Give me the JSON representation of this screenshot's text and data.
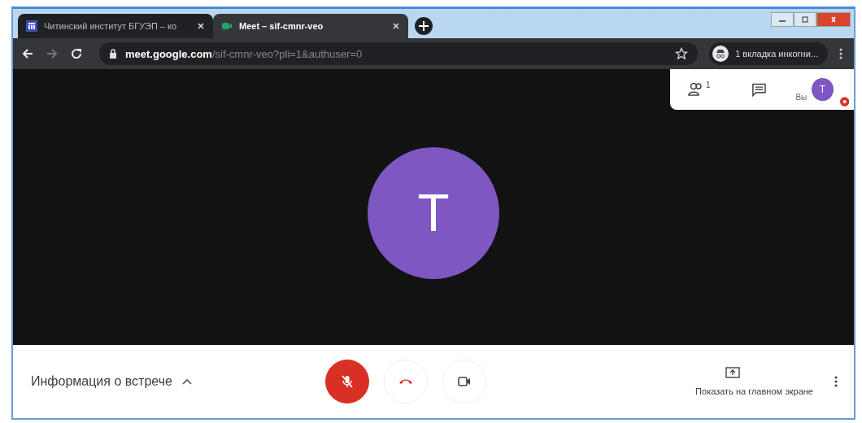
{
  "tabs": [
    {
      "title": "Читинский институт БГУЭП – ко",
      "selected": false
    },
    {
      "title": "Meet – sif-cmnr-veo",
      "selected": true
    }
  ],
  "address_bar": {
    "host": "meet.google.com",
    "path": "/sif-cmnr-veo?pli=1&authuser=0"
  },
  "profile": {
    "label": "1 вкладка инкогни..."
  },
  "meeting_panel": {
    "participants_count": "1",
    "self_label": "Вы",
    "self_initial": "T"
  },
  "main_avatar": {
    "initial": "T"
  },
  "bottom_bar": {
    "info_label": "Информация о встрече",
    "info_expanded": false,
    "mic_muted": true,
    "present_label": "Показать на главном экране"
  }
}
